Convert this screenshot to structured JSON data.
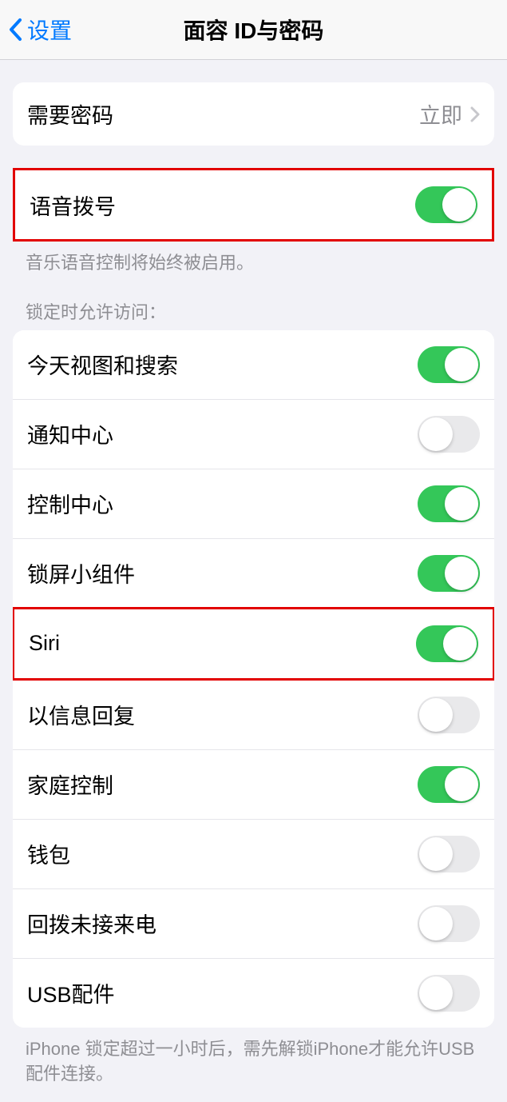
{
  "header": {
    "back_label": "设置",
    "title": "面容 ID与密码"
  },
  "require_passcode": {
    "label": "需要密码",
    "value": "立即"
  },
  "voice_dial": {
    "label": "语音拨号",
    "on": true,
    "footer": "音乐语音控制将始终被启用。"
  },
  "locked_section": {
    "header": "锁定时允许访问：",
    "items": [
      {
        "label": "今天视图和搜索",
        "on": true
      },
      {
        "label": "通知中心",
        "on": false
      },
      {
        "label": "控制中心",
        "on": true
      },
      {
        "label": "锁屏小组件",
        "on": true
      },
      {
        "label": "Siri",
        "on": true
      },
      {
        "label": "以信息回复",
        "on": false
      },
      {
        "label": "家庭控制",
        "on": true
      },
      {
        "label": "钱包",
        "on": false
      },
      {
        "label": "回拨未接来电",
        "on": false
      },
      {
        "label": "USB配件",
        "on": false
      }
    ],
    "footer": "iPhone 锁定超过一小时后，需先解锁iPhone才能允许USB 配件连接。"
  }
}
